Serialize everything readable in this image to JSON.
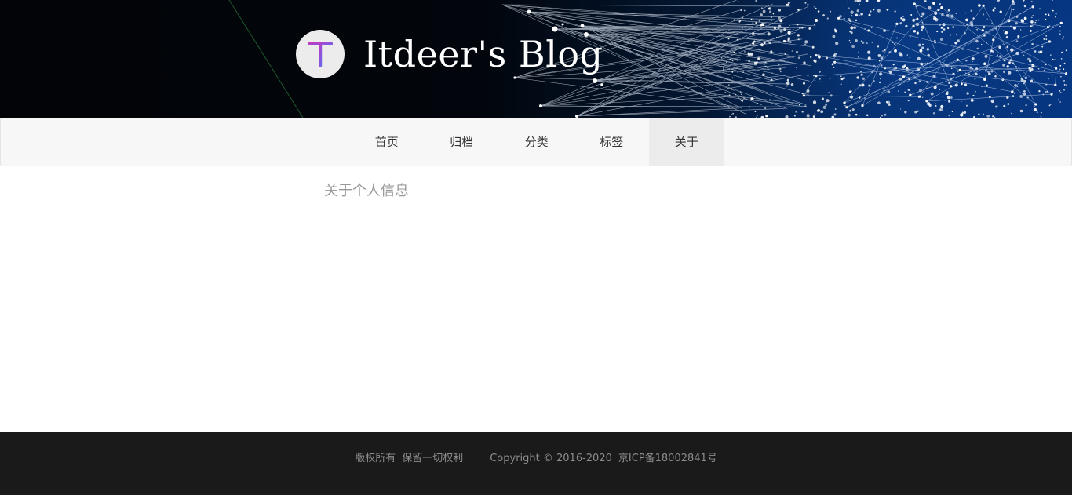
{
  "site": {
    "title": "Itdeer's Blog",
    "avatar_letter": "T"
  },
  "nav": {
    "items": [
      {
        "label": "首页"
      },
      {
        "label": "归档"
      },
      {
        "label": "分类"
      },
      {
        "label": "标签"
      },
      {
        "label": "关于",
        "active": true
      }
    ]
  },
  "main": {
    "heading": "关于个人信息"
  },
  "footer": {
    "rights": "版权所有",
    "reserved": "保留一切权利",
    "copyright": "Copyright © 2016-2020",
    "icp": "京ICP备18002841号"
  },
  "colors": {
    "banner_dark": "#020407",
    "banner_blue": "#06357f",
    "nav_bg": "#f7f7f7",
    "nav_active_bg": "#ececec",
    "footer_bg": "#1a1a1a"
  }
}
